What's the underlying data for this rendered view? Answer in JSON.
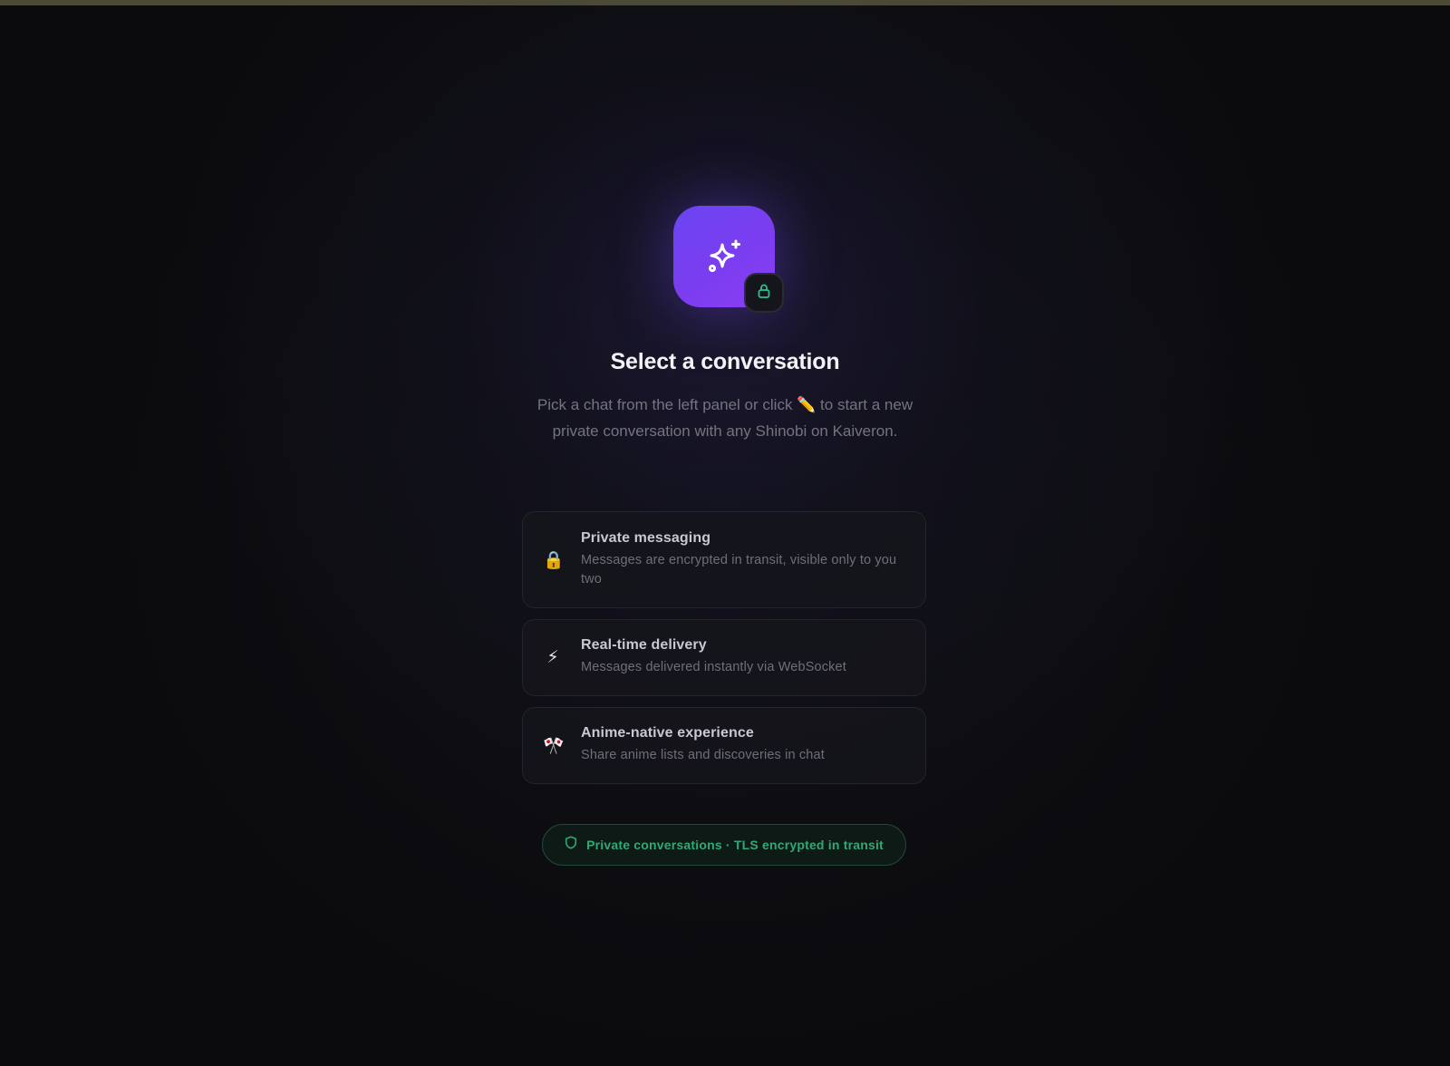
{
  "empty_state": {
    "title": "Select a conversation",
    "subtitle": "Pick a chat from the left panel or click ✏️ to start a new private conversation with any Shinobi on Kaiveron.",
    "hero_icon": "sparkles-icon",
    "badge_icon": "lock-icon",
    "accent_color": "#6a45f2",
    "badge_color": "#2fbf8f"
  },
  "features": [
    {
      "icon": "🔒",
      "title": "Private messaging",
      "description": "Messages are encrypted in transit, visible only to you two"
    },
    {
      "icon": "⚡",
      "title": "Real-time delivery",
      "description": "Messages delivered instantly via WebSocket"
    },
    {
      "icon": "🎌",
      "title": "Anime-native experience",
      "description": "Share anime lists and discoveries in chat"
    }
  ],
  "footer": {
    "icon": "shield-icon",
    "text": "Private conversations · TLS encrypted in transit",
    "color": "#32a877"
  }
}
